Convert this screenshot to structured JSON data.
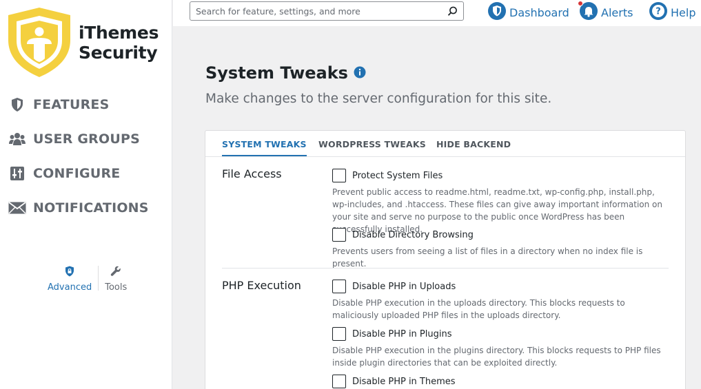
{
  "brand": {
    "line1": "iThemes",
    "line2": "Security",
    "color": "#f4d03f"
  },
  "sidebar": {
    "items": [
      {
        "label": "FEATURES",
        "icon": "shield-icon"
      },
      {
        "label": "USER GROUPS",
        "icon": "users-icon"
      },
      {
        "label": "CONFIGURE",
        "icon": "sliders-icon"
      },
      {
        "label": "NOTIFICATIONS",
        "icon": "envelope-icon"
      }
    ],
    "tools": [
      {
        "label": "Advanced",
        "icon": "shield-lock-icon",
        "active": true
      },
      {
        "label": "Tools",
        "icon": "wrench-icon",
        "active": false
      }
    ]
  },
  "topbar": {
    "search_placeholder": "Search for feature, settings, and more",
    "links": [
      {
        "label": "Dashboard",
        "icon": "shield-check-icon"
      },
      {
        "label": "Alerts",
        "icon": "bell-icon"
      },
      {
        "label": "Help",
        "icon": "question-icon"
      }
    ]
  },
  "page": {
    "title": "System Tweaks",
    "subtitle": "Make changes to the server configuration for this site."
  },
  "tabs": [
    {
      "label": "SYSTEM TWEAKS",
      "active": true
    },
    {
      "label": "WORDPRESS TWEAKS",
      "active": false
    },
    {
      "label": "HIDE BACKEND",
      "active": false
    }
  ],
  "sections": [
    {
      "title": "File Access",
      "options": [
        {
          "label": "Protect System Files",
          "checked": false,
          "description": "Prevent public access to readme.html, readme.txt, wp-config.php, install.php, wp-includes, and .htaccess. These files can give away important information on your site and serve no purpose to the public once WordPress has been successfully installed."
        },
        {
          "label": "Disable Directory Browsing",
          "checked": false,
          "description": "Prevents users from seeing a list of files in a directory when no index file is present."
        }
      ]
    },
    {
      "title": "PHP Execution",
      "options": [
        {
          "label": "Disable PHP in Uploads",
          "checked": false,
          "description": "Disable PHP execution in the uploads directory. This blocks requests to maliciously uploaded PHP files in the uploads directory."
        },
        {
          "label": "Disable PHP in Plugins",
          "checked": false,
          "description": "Disable PHP execution in the plugins directory. This blocks requests to PHP files inside plugin directories that can be exploited directly."
        },
        {
          "label": "Disable PHP in Themes",
          "checked": false,
          "description": ""
        }
      ]
    }
  ],
  "colors": {
    "accent": "#2271b1",
    "alert_dot": "#d63638",
    "muted": "#646970"
  }
}
